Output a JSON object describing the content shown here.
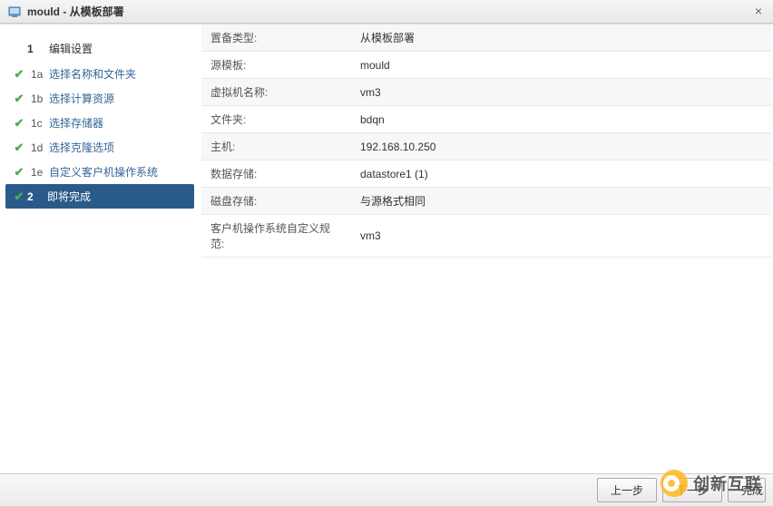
{
  "titlebar": {
    "title": "mould - 从模板部署"
  },
  "sidebar": {
    "header": {
      "num": "1",
      "label": "编辑设置"
    },
    "steps": [
      {
        "sub": "1a",
        "label": "选择名称和文件夹",
        "done": true
      },
      {
        "sub": "1b",
        "label": "选择计算资源",
        "done": true
      },
      {
        "sub": "1c",
        "label": "选择存储器",
        "done": true
      },
      {
        "sub": "1d",
        "label": "选择克隆选项",
        "done": true
      },
      {
        "sub": "1e",
        "label": "自定义客户机操作系统",
        "done": true
      }
    ],
    "active": {
      "num": "2",
      "label": "即将完成"
    }
  },
  "summary": [
    {
      "label": "置备类型:",
      "value": "从模板部署"
    },
    {
      "label": "源模板:",
      "value": "mould"
    },
    {
      "label": "虚拟机名称:",
      "value": "vm3"
    },
    {
      "label": "文件夹:",
      "value": "bdqn"
    },
    {
      "label": "主机:",
      "value": "192.168.10.250"
    },
    {
      "label": "数据存储:",
      "value": "datastore1 (1)"
    },
    {
      "label": "磁盘存储:",
      "value": "与源格式相同"
    },
    {
      "label": "客户机操作系统自定义规范:",
      "value": "vm3"
    }
  ],
  "footer": {
    "back": "上一步",
    "next": "下一步",
    "finish": "完成"
  },
  "watermark": "创新互联"
}
